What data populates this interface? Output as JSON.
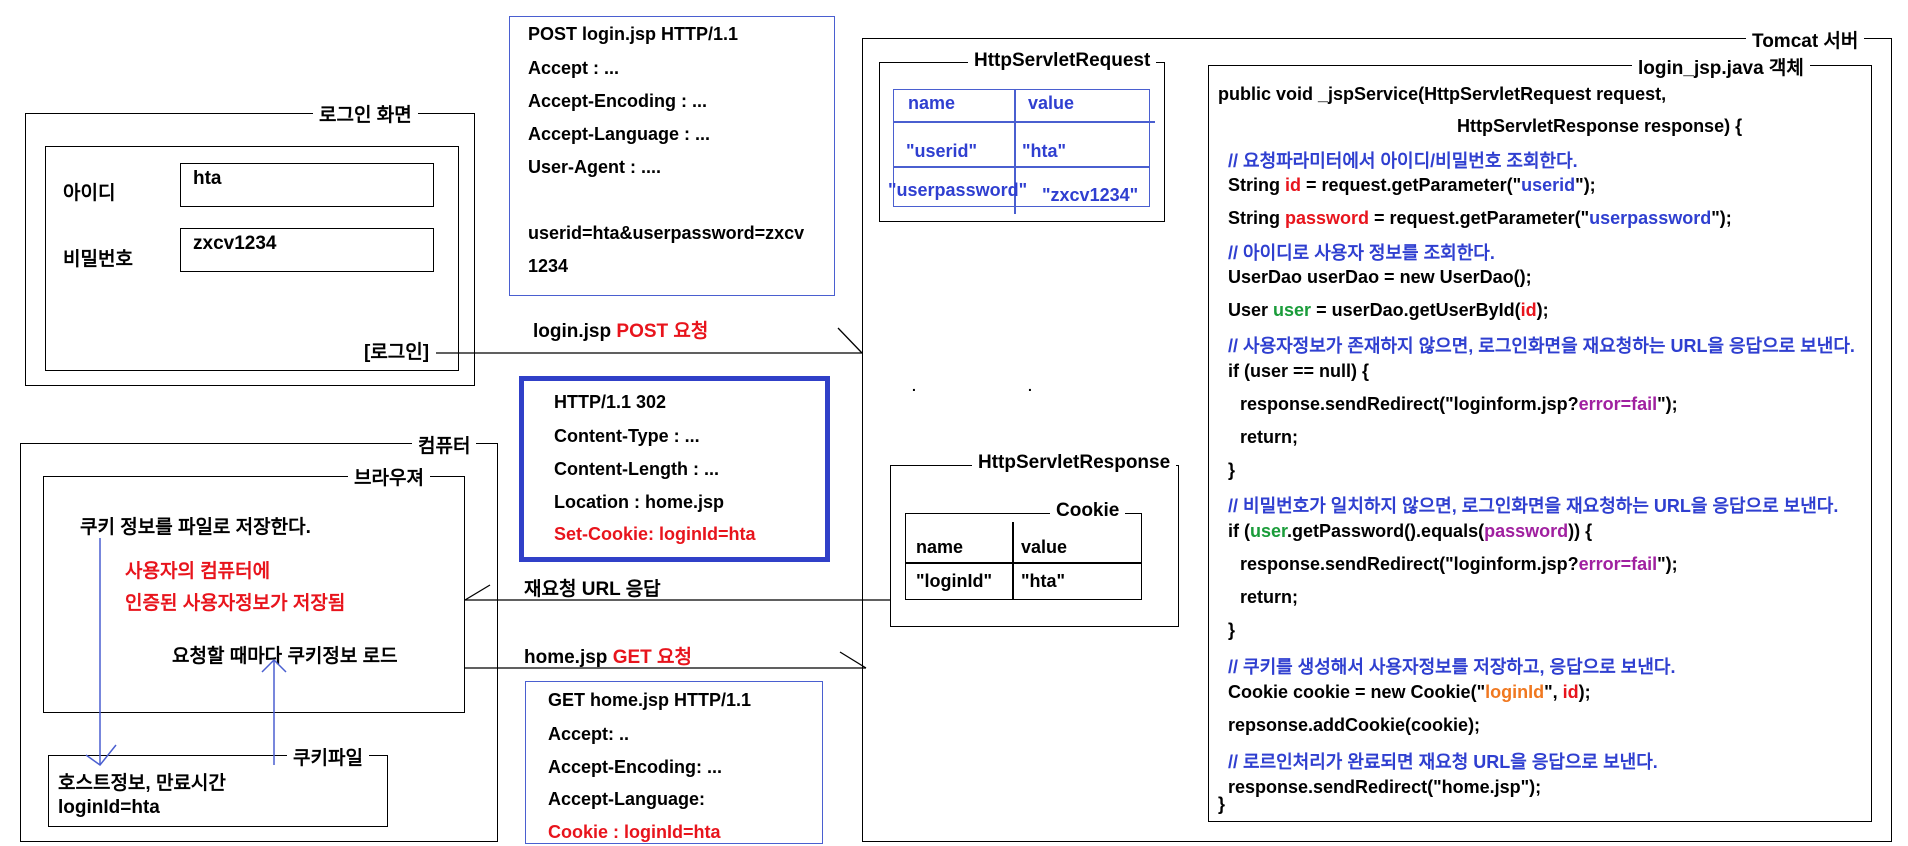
{
  "login_screen": {
    "title": "로그인 화면",
    "id_label": "아이디",
    "id_value": "hta",
    "pw_label": "비밀번호",
    "pw_value": "zxcv1234",
    "login_button": "[로그인]"
  },
  "computer": {
    "title": "컴퓨터",
    "browser_title": "브라우져",
    "save_text": "쿠키 정보를 파일로 저장한다.",
    "note_line1": "사용자의 컴퓨터에",
    "note_line2": "인증된 사용자정보가 저장됨",
    "load_text": "요청할  때마다 쿠키정보 로드",
    "cookie_file_title": "쿠키파일",
    "cookie_file_line1": "호스트정보, 만료시간",
    "cookie_file_line2": "loginId=hta"
  },
  "post_request": {
    "lines": [
      "POST  login.jsp  HTTP/1.1",
      "Accept : ...",
      "Accept-Encoding : ...",
      "Accept-Language : ...",
      "User-Agent : ...."
    ],
    "body_line1": "userid=hta&userpassword=zxcv",
    "body_line2": "1234"
  },
  "arrow_labels": {
    "post_prefix": "login.jsp ",
    "post_suffix": "POST 요청",
    "redirect": "재요청 URL 응답",
    "get_prefix": "home.jsp ",
    "get_suffix": "GET 요청"
  },
  "response_302": {
    "lines": [
      "HTTP/1.1  302",
      "Content-Type : ...",
      "Content-Length : ...",
      "Location : home.jsp"
    ],
    "set_cookie": "Set-Cookie: loginId=hta"
  },
  "get_request": {
    "lines": [
      "GET home.jsp HTTP/1.1",
      "Accept: ..",
      "Accept-Encoding: ...",
      "Accept-Language:"
    ],
    "cookie": "Cookie : loginId=hta"
  },
  "tomcat": {
    "title": "Tomcat 서버",
    "request": {
      "title": "HttpServletRequest",
      "headers": [
        "name",
        "value"
      ],
      "rows": [
        [
          "\"userid\"",
          "\"hta\""
        ],
        [
          "\"userpassword\"",
          "\"zxcv1234\""
        ]
      ]
    },
    "response": {
      "title": "HttpServletResponse",
      "cookie_title": "Cookie",
      "headers": [
        "name",
        "value"
      ],
      "rows": [
        [
          "\"loginId\"",
          "\"hta\""
        ]
      ]
    },
    "dots": [
      ".",
      "."
    ],
    "java_title": "login_jsp.java 객체",
    "code": {
      "l1": "public void _jspService(HttpServletRequest request,",
      "l2": "HttpServletResponse response) {",
      "c1": "// 요청파라미터에서 아이디/비밀번호 조회한다.",
      "l3a": "String ",
      "l3b": "id",
      "l3c": " = request.getParameter(\"",
      "l3d": "userid",
      "l3e": "\");",
      "l4a": "String ",
      "l4b": "password",
      "l4c": " = request.getParameter(\"",
      "l4d": "userpassword",
      "l4e": "\");",
      "c2": "// 아이디로 사용자 정보를 조회한다.",
      "l5": "UserDao userDao = new UserDao();",
      "l6a": "User ",
      "l6b": "user",
      "l6c": " = userDao.getUserById(",
      "l6d": "id",
      "l6e": ");",
      "c3": "// 사용자정보가 존재하지 않으면, 로그인화면을 재요청하는 URL을 응답으로 보낸다.",
      "l7": "if (user == null) {",
      "l8a": "response.sendRedirect(\"loginform.jsp?",
      "l8b": "error=fail",
      "l8c": "\");",
      "l9": "return;",
      "l10": "}",
      "c4": "// 비밀번호가 일치하지 않으면, 로그인화면을 재요청하는 URL을 응답으로 보낸다.",
      "l11a": "if (",
      "l11b": "user",
      "l11c": ".getPassword().equals(",
      "l11d": "password",
      "l11e": ")) {",
      "l12a": "response.sendRedirect(\"loginform.jsp?",
      "l12b": "error=fail",
      "l12c": "\");",
      "l13": "return;",
      "l14": "}",
      "c5": "// 쿠키를 생성해서 사용자정보를 저장하고, 응답으로 보낸다.",
      "l15a": "Cookie cookie = new Cookie(\"",
      "l15b": "loginId",
      "l15c": "\", ",
      "l15d": "id",
      "l15e": ");",
      "l16": "repsonse.addCookie(cookie);",
      "c6": "// 로르인처리가 완료되면 재요청 URL을 응답으로 보낸다.",
      "l17": "response.sendRedirect(\"home.jsp\");",
      "l18": "}"
    }
  },
  "colors": {
    "red": "#e8141c",
    "blue": "#2f3fd0",
    "green": "#1a9c3a",
    "purple": "#a020a0",
    "orange": "#f07820"
  }
}
